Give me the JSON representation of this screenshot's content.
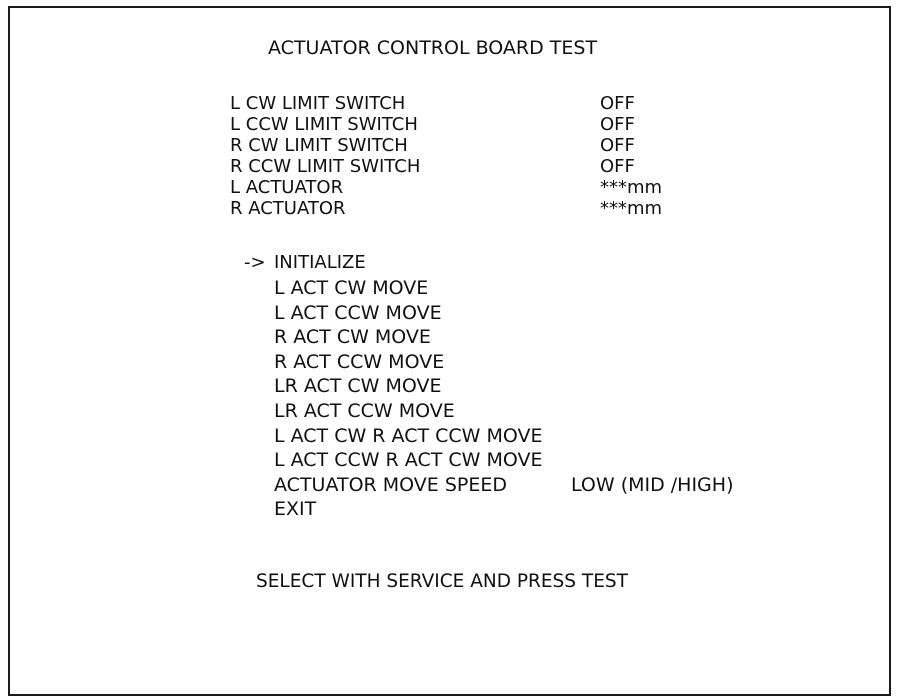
{
  "title": "ACTUATOR CONTROL BOARD TEST",
  "status_rows": [
    {
      "label": "L CW LIMIT SWITCH",
      "value": "OFF"
    },
    {
      "label": "L CCW LIMIT SWITCH",
      "value": "OFF"
    },
    {
      "label": "R CW LIMIT SWITCH",
      "value": "OFF"
    },
    {
      "label": "R CCW LIMIT SWITCH",
      "value": "OFF"
    },
    {
      "label": "L ACTUATOR",
      "value": "***mm"
    },
    {
      "label": "R ACTUATOR",
      "value": "***mm"
    }
  ],
  "cursor": "->",
  "menu": {
    "initialize": "INITIALIZE",
    "items": [
      {
        "label": "L ACT CW MOVE",
        "value": ""
      },
      {
        "label": "L ACT CCW MOVE",
        "value": ""
      },
      {
        "label": "R ACT CW MOVE",
        "value": ""
      },
      {
        "label": "R ACT CCW MOVE",
        "value": ""
      },
      {
        "label": "LR ACT CW MOVE",
        "value": ""
      },
      {
        "label": "LR ACT CCW MOVE",
        "value": ""
      },
      {
        "label": "L ACT CW R ACT CCW MOVE",
        "value": ""
      },
      {
        "label": "L ACT CCW R ACT CW MOVE",
        "value": ""
      },
      {
        "label": "ACTUATOR MOVE SPEED",
        "value": "LOW (MID /HIGH)"
      },
      {
        "label": "EXIT",
        "value": ""
      }
    ]
  },
  "footer": "SELECT WITH SERVICE AND PRESS TEST"
}
